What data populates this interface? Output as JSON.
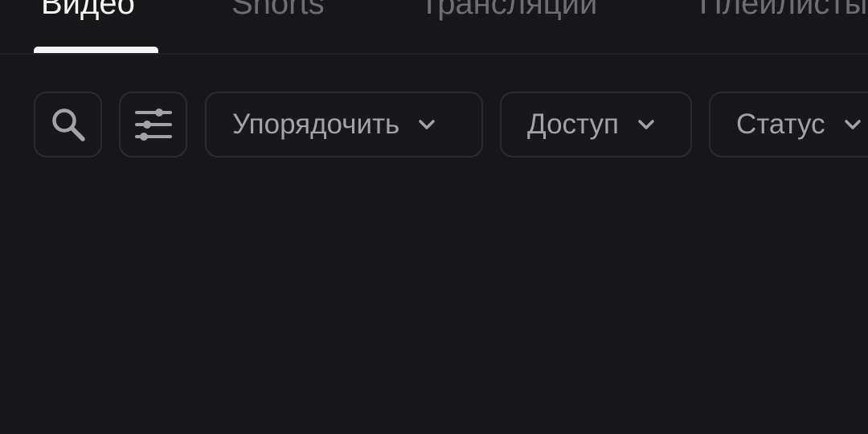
{
  "tabs": [
    {
      "label": "Видео",
      "active": true
    },
    {
      "label": "Shorts",
      "active": false
    },
    {
      "label": "Трансляции",
      "active": false
    },
    {
      "label": "Плейлисты",
      "active": false
    }
  ],
  "filters": {
    "search_icon": "search-icon",
    "filter_icon": "sliders-icon",
    "sort_label": "Упорядочить",
    "access_label": "Доступ",
    "status_label": "Статус"
  },
  "colors": {
    "background": "#18181a",
    "active_tab": "#f5f5f5",
    "inactive_tab": "#6e6e72",
    "button_border": "#2c2c2f",
    "button_text": "#a3a3a7"
  }
}
